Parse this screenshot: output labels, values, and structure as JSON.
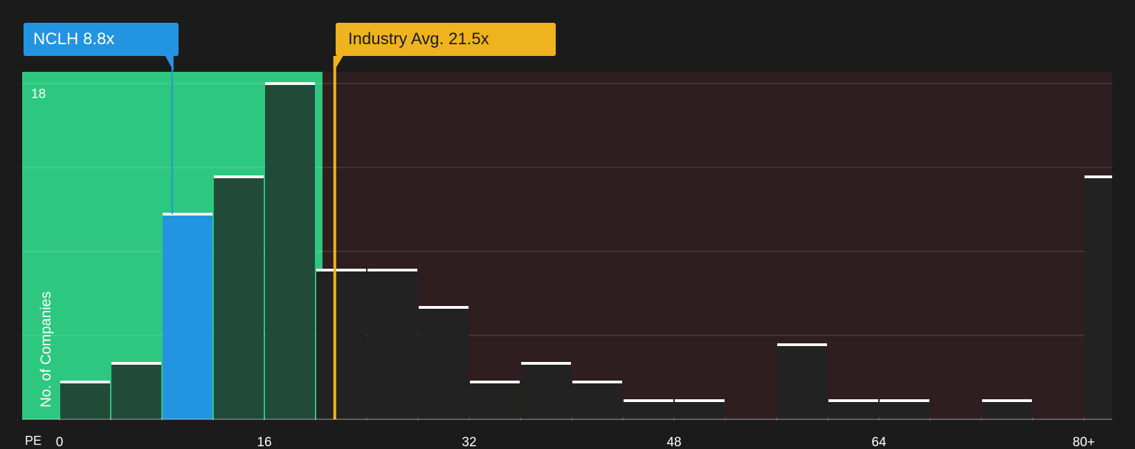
{
  "chart_data": {
    "type": "bar",
    "xlabel": "PE",
    "ylabel": "No. of Companies",
    "x_ticks": [
      "0",
      "16",
      "32",
      "48",
      "64",
      "80+"
    ],
    "y_max_label": "18",
    "ylim": [
      0,
      18
    ],
    "bin_width": 4,
    "bars": [
      {
        "x0": 0,
        "value": 2,
        "highlight": false
      },
      {
        "x0": 4,
        "value": 3,
        "highlight": false
      },
      {
        "x0": 8,
        "value": 11,
        "highlight": true
      },
      {
        "x0": 12,
        "value": 13,
        "highlight": false
      },
      {
        "x0": 16,
        "value": 18,
        "highlight": false
      },
      {
        "x0": 20,
        "value": 8,
        "highlight": false
      },
      {
        "x0": 24,
        "value": 8,
        "highlight": false
      },
      {
        "x0": 28,
        "value": 6,
        "highlight": false
      },
      {
        "x0": 32,
        "value": 2,
        "highlight": false
      },
      {
        "x0": 36,
        "value": 3,
        "highlight": false
      },
      {
        "x0": 40,
        "value": 2,
        "highlight": false
      },
      {
        "x0": 44,
        "value": 1,
        "highlight": false
      },
      {
        "x0": 48,
        "value": 1,
        "highlight": false
      },
      {
        "x0": 56,
        "value": 4,
        "highlight": false
      },
      {
        "x0": 60,
        "value": 1,
        "highlight": false
      },
      {
        "x0": 64,
        "value": 1,
        "highlight": false
      },
      {
        "x0": 72,
        "value": 1,
        "highlight": false
      },
      {
        "x0": 80,
        "value": 13,
        "highlight": false
      }
    ],
    "company": {
      "label": "NCLH 8.8x",
      "value": 8.8
    },
    "industry": {
      "label": "Industry Avg. 21.5x",
      "value": 21.5
    },
    "grid": true
  },
  "colors": {
    "background": "#1b1b1b",
    "undervalued_zone": "#2ec77f",
    "overvalued_zone": "#2f1e1f",
    "bar_in_zone": "#214a39",
    "bar_out_zone": "#232222",
    "highlight_bar": "#2394e1",
    "industry_line": "#eeb31f",
    "bar_cap": "#ffffff"
  }
}
